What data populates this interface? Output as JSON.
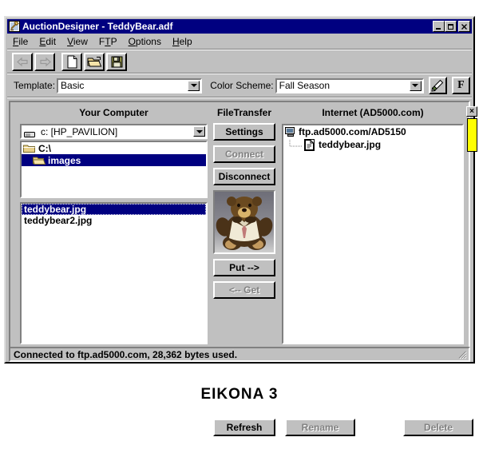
{
  "window": {
    "title": "AuctionDesigner - TeddyBear.adf",
    "icon": "auction-gavel-icon",
    "controls": [
      {
        "name": "minimize",
        "glyph": "_"
      },
      {
        "name": "maximize",
        "glyph": "□"
      },
      {
        "name": "close",
        "glyph": "×"
      }
    ]
  },
  "menu": [
    {
      "pre": "",
      "key": "F",
      "post": "ile"
    },
    {
      "pre": "",
      "key": "E",
      "post": "dit"
    },
    {
      "pre": "",
      "key": "V",
      "post": "iew"
    },
    {
      "pre": "F",
      "key": "T",
      "post": "P"
    },
    {
      "pre": "",
      "key": "O",
      "post": "ptions"
    },
    {
      "pre": "",
      "key": "H",
      "post": "elp"
    }
  ],
  "toolbar": {
    "buttons": [
      {
        "name": "back-button",
        "icon": "arrow-left-icon",
        "disabled": true
      },
      {
        "name": "forward-button",
        "icon": "arrow-right-icon",
        "disabled": true
      },
      {
        "name": "new-button",
        "icon": "new-document-icon",
        "disabled": false
      },
      {
        "name": "open-button",
        "icon": "open-folder-icon",
        "disabled": false
      },
      {
        "name": "save-button",
        "icon": "floppy-disk-icon",
        "disabled": false
      }
    ]
  },
  "template_row": {
    "template_label": "Template:",
    "template_value": "Basic",
    "color_scheme_label": "Color Scheme:",
    "color_scheme_value": "Fall Season",
    "paint_button_icon": "paintbrush-icon",
    "font_button_label": "F"
  },
  "left_panel": {
    "title": "Your Computer",
    "drive_value": "c: [HP_PAVILION]",
    "drive_icon": "drive-icon",
    "folders": [
      {
        "label": "C:\\",
        "indent": 0,
        "selected": false,
        "icon": "folder-icon"
      },
      {
        "label": "images",
        "indent": 1,
        "selected": true,
        "icon": "folder-open-icon"
      }
    ],
    "files": [
      {
        "label": "teddybear.jpg",
        "selected": true
      },
      {
        "label": "teddybear2.jpg",
        "selected": false
      }
    ]
  },
  "middle_panel": {
    "title": "FileTransfer",
    "buttons": [
      {
        "name": "settings-button",
        "label": "Settings",
        "disabled": false
      },
      {
        "name": "connect-button",
        "label": "Connect",
        "disabled": true
      },
      {
        "name": "disconnect-button",
        "label": "Disconnect",
        "disabled": false
      }
    ],
    "preview_alt": "teddy-bear-preview",
    "transfer_buttons": [
      {
        "name": "put-button",
        "label": "Put -->",
        "disabled": false
      },
      {
        "name": "get-button",
        "label": "<-- Get",
        "disabled": true
      }
    ]
  },
  "right_panel": {
    "title": "Internet (AD5000.com)",
    "close_glyph": "×",
    "tree": [
      {
        "label": "ftp.ad5000.com/AD5150",
        "indent": 0,
        "icon": "server-icon"
      },
      {
        "label": "teddybear.jpg",
        "indent": 1,
        "icon": "file-icon"
      }
    ]
  },
  "bottom_buttons": [
    {
      "name": "refresh-button",
      "label": "Refresh",
      "disabled": false
    },
    {
      "name": "rename-button",
      "label": "Rename",
      "disabled": true
    },
    {
      "name": "delete-button",
      "label": "Delete",
      "disabled": true
    }
  ],
  "status_bar": {
    "text": "Connected to ftp.ad5000.com, 28,362 bytes used."
  },
  "caption": "EIKONA 3",
  "colors": {
    "titlebar": "#000080",
    "face": "#c0c0c0",
    "selection": "#000080",
    "highlight_bar": "#ffff00"
  }
}
